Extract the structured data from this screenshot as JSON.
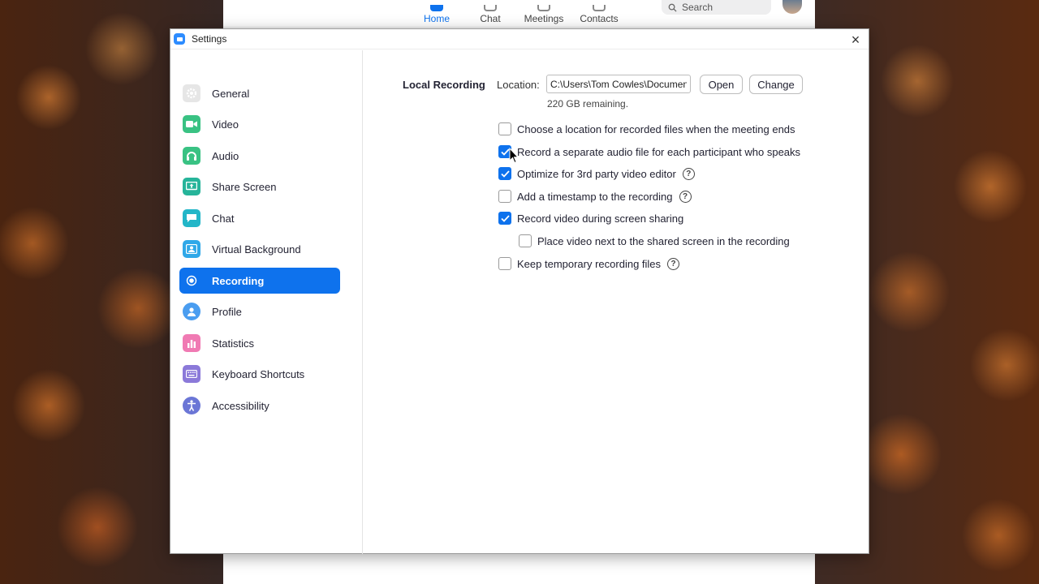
{
  "main_window": {
    "nav": [
      {
        "label": "Home",
        "active": true
      },
      {
        "label": "Chat",
        "active": false
      },
      {
        "label": "Meetings",
        "active": false
      },
      {
        "label": "Contacts",
        "active": false
      }
    ],
    "search_label": "Search"
  },
  "dialog": {
    "title": "Settings",
    "close_icon": "×"
  },
  "sidebar": {
    "items": [
      {
        "label": "General",
        "icon": "gear-icon",
        "color": "#d9d9d9"
      },
      {
        "label": "Video",
        "icon": "video-icon",
        "color": "#39c283"
      },
      {
        "label": "Audio",
        "icon": "headphones-icon",
        "color": "#39c283"
      },
      {
        "label": "Share Screen",
        "icon": "share-screen-icon",
        "color": "#26b49a"
      },
      {
        "label": "Chat",
        "icon": "chat-icon",
        "color": "#23b6c8"
      },
      {
        "label": "Virtual Background",
        "icon": "virtual-background-icon",
        "color": "#30a8e8"
      },
      {
        "label": "Recording",
        "icon": "recording-icon",
        "color": "#0e72ed",
        "active": true
      },
      {
        "label": "Profile",
        "icon": "profile-icon",
        "color": "#4a9df0"
      },
      {
        "label": "Statistics",
        "icon": "statistics-icon",
        "color": "#f07ab3"
      },
      {
        "label": "Keyboard Shortcuts",
        "icon": "keyboard-icon",
        "color": "#8b79d9"
      },
      {
        "label": "Accessibility",
        "icon": "accessibility-icon",
        "color": "#6b76d6"
      }
    ]
  },
  "recording": {
    "section_label": "Local Recording",
    "location_label": "Location:",
    "location_value": "C:\\Users\\Tom Cowles\\Documents\\Zoom",
    "open_label": "Open",
    "change_label": "Change",
    "remaining": "220 GB remaining.",
    "options": [
      {
        "label": "Choose a location for recorded files when the meeting ends",
        "checked": false,
        "help": false
      },
      {
        "label": "Record a separate audio file for each participant who speaks",
        "checked": true,
        "help": false
      },
      {
        "label": "Optimize for 3rd party video editor",
        "checked": true,
        "help": true
      },
      {
        "label": "Add a timestamp to the recording",
        "checked": false,
        "help": true
      },
      {
        "label": "Record video during screen sharing",
        "checked": true,
        "help": false
      },
      {
        "label": "Place video next to the shared screen in the recording",
        "checked": false,
        "help": false,
        "indent": true
      },
      {
        "label": "Keep temporary recording files",
        "checked": false,
        "help": true
      }
    ],
    "help_glyph": "?"
  },
  "colors": {
    "accent": "#0e72ed",
    "text": "#232333"
  }
}
